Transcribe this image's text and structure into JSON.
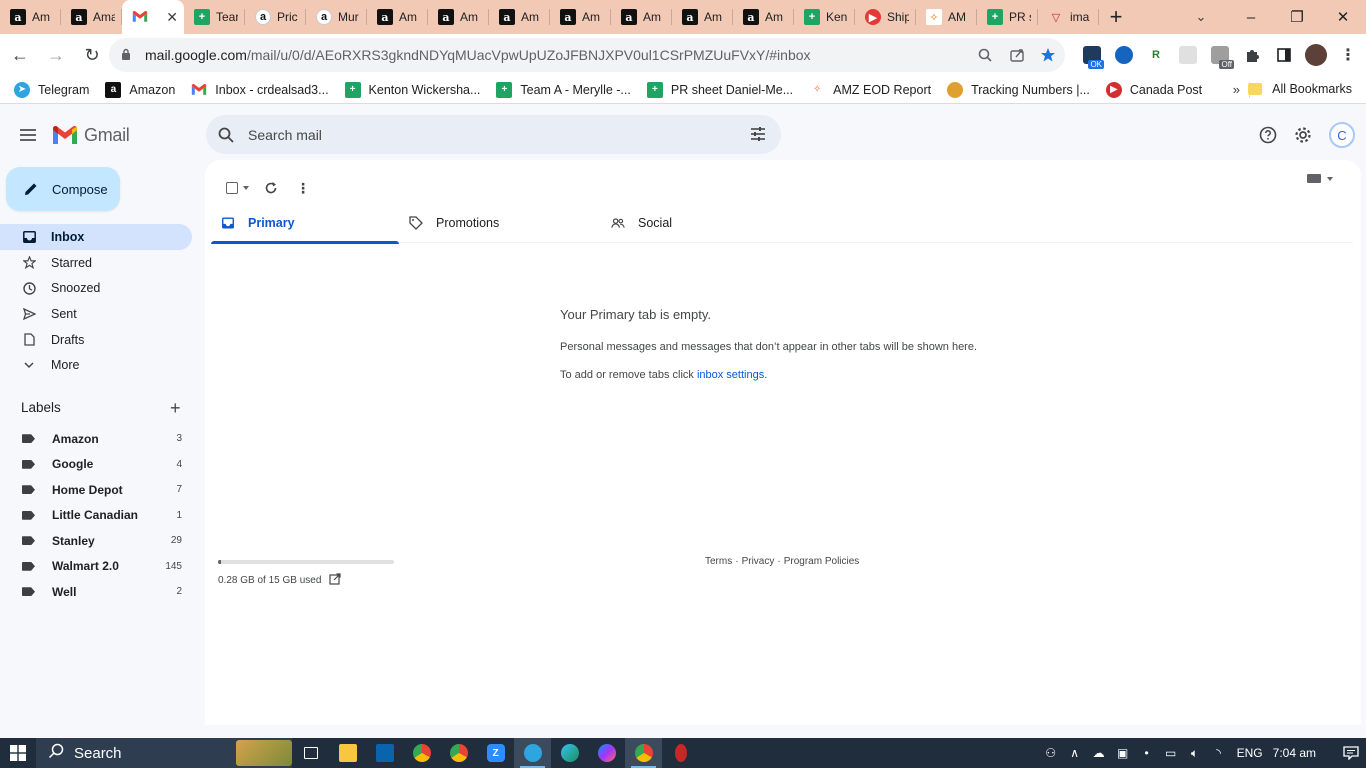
{
  "browser": {
    "tabs": [
      {
        "title": "Am",
        "icon": "amazon-icon"
      },
      {
        "title": "Ama",
        "icon": "amazon-icon"
      },
      {
        "title": "",
        "icon": "gmail-icon",
        "active": true
      },
      {
        "title": "Tear",
        "icon": "sheets-icon"
      },
      {
        "title": "Pric",
        "icon": "amazon-round-icon"
      },
      {
        "title": "Mur",
        "icon": "amazon-round-icon"
      },
      {
        "title": "Am",
        "icon": "amazon-icon"
      },
      {
        "title": "Am",
        "icon": "amazon-icon"
      },
      {
        "title": "Am",
        "icon": "amazon-icon"
      },
      {
        "title": "Am",
        "icon": "amazon-icon"
      },
      {
        "title": "Am",
        "icon": "amazon-icon"
      },
      {
        "title": "Am",
        "icon": "amazon-icon"
      },
      {
        "title": "Am",
        "icon": "amazon-icon"
      },
      {
        "title": "Ken",
        "icon": "sheets-icon"
      },
      {
        "title": "Ship",
        "icon": "shipping-icon"
      },
      {
        "title": "AM",
        "icon": "amz-eod-icon"
      },
      {
        "title": "PR s",
        "icon": "sheets-icon"
      },
      {
        "title": "ima",
        "icon": "image-icon"
      }
    ],
    "url_host": "mail.google.com",
    "url_path": "/mail/u/0/d/AEoRXRS3gkndNDYqMUacVpwUpUZoJFBNJXPV0ul1CSrPMZUuFVxY/#inbox",
    "bookmarks": [
      {
        "label": "Telegram",
        "icon": "telegram-icon"
      },
      {
        "label": "Amazon",
        "icon": "amazon-icon"
      },
      {
        "label": "Inbox - crdealsad3...",
        "icon": "gmail-icon"
      },
      {
        "label": "Kenton Wickersha...",
        "icon": "sheets-icon"
      },
      {
        "label": "Team A - Merylle -...",
        "icon": "sheets-icon"
      },
      {
        "label": "PR sheet Daniel-Me...",
        "icon": "sheets-icon"
      },
      {
        "label": "AMZ EOD Report",
        "icon": "amz-eod-icon"
      },
      {
        "label": "Tracking Numbers |...",
        "icon": "tracking-icon"
      },
      {
        "label": "Canada Post",
        "icon": "canada-post-icon"
      }
    ],
    "all_bookmarks": "All Bookmarks",
    "ext_ok_badge": "OK",
    "ext_off_badge": "Off"
  },
  "gmail": {
    "wordmark": "Gmail",
    "search_placeholder": "Search mail",
    "avatar_initial": "C",
    "compose": "Compose",
    "nav": [
      {
        "label": "Inbox",
        "icon": "inbox-icon",
        "active": true
      },
      {
        "label": "Starred",
        "icon": "star-icon"
      },
      {
        "label": "Snoozed",
        "icon": "clock-icon"
      },
      {
        "label": "Sent",
        "icon": "send-icon"
      },
      {
        "label": "Drafts",
        "icon": "draft-icon"
      },
      {
        "label": "More",
        "icon": "chevron-down-icon"
      }
    ],
    "labels_title": "Labels",
    "labels": [
      {
        "name": "Amazon",
        "count": "3"
      },
      {
        "name": "Google",
        "count": "4"
      },
      {
        "name": "Home Depot",
        "count": "7"
      },
      {
        "name": "Little Canadian",
        "count": "1"
      },
      {
        "name": "Stanley",
        "count": "29"
      },
      {
        "name": "Walmart 2.0",
        "count": "145"
      },
      {
        "name": "Well",
        "count": "2"
      }
    ],
    "categories": [
      {
        "label": "Primary",
        "icon": "inbox-icon",
        "active": true
      },
      {
        "label": "Promotions",
        "icon": "tag-icon"
      },
      {
        "label": "Social",
        "icon": "people-icon"
      }
    ],
    "empty": {
      "title": "Your Primary tab is empty.",
      "line1": "Personal messages and messages that don’t appear in other tabs will be shown here.",
      "line2_prefix": "To add or remove tabs click ",
      "line2_link": "inbox settings",
      "line2_suffix": "."
    },
    "storage": {
      "text": "0.28 GB of 15 GB used",
      "used_fraction": 0.019
    },
    "footer": {
      "terms": "Terms",
      "privacy": "Privacy",
      "policies": "Program Policies",
      "sep": "·"
    }
  },
  "taskbar": {
    "search": "Search",
    "lang": "ENG",
    "time": "7:04 am"
  },
  "colors": {
    "accent": "#0b57d0",
    "compose_bg": "#c2e7ff",
    "active_nav": "#d3e3fd",
    "tabstrip": "#f1c9b5"
  }
}
